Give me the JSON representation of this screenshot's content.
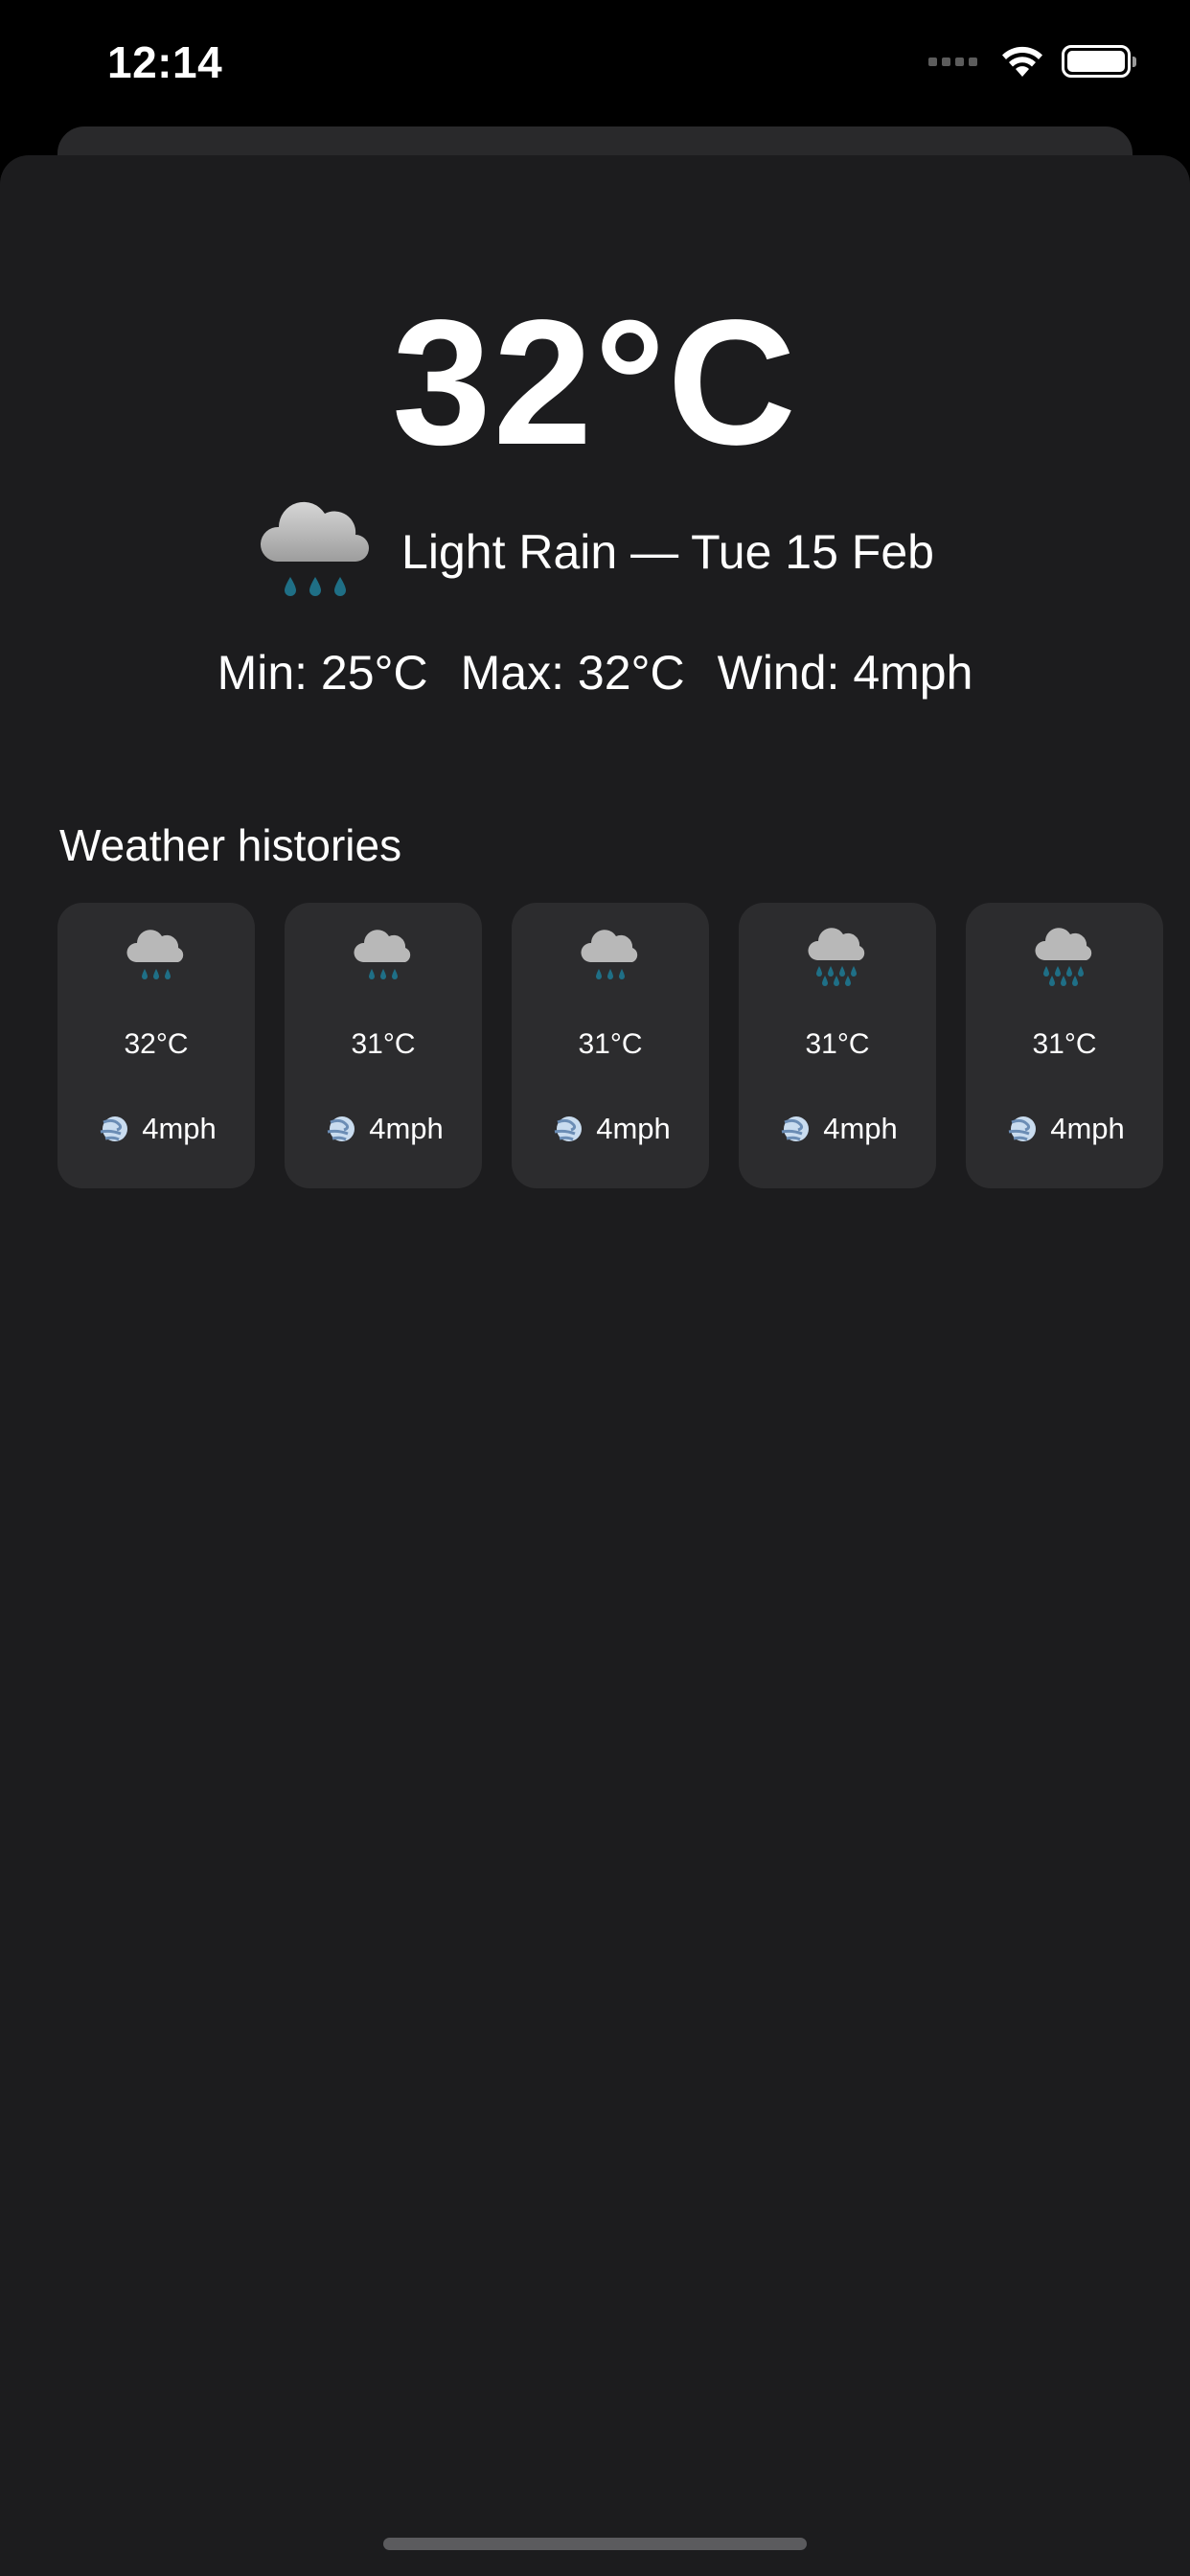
{
  "status_bar": {
    "time": "12:14",
    "wifi_icon": "wifi-icon",
    "battery_icon": "battery-icon"
  },
  "current": {
    "temperature": "32°C",
    "condition_icon": "cloud-rain-icon",
    "condition_text": "Light Rain — Tue 15 Feb",
    "min": "Min: 25°C",
    "max": "Max: 32°C",
    "wind": "Wind: 4mph"
  },
  "histories": {
    "title": "Weather histories",
    "items": [
      {
        "icon": "cloud-rain-icon",
        "temp": "32°C",
        "wind": "4mph"
      },
      {
        "icon": "cloud-rain-icon",
        "temp": "31°C",
        "wind": "4mph"
      },
      {
        "icon": "cloud-rain-icon",
        "temp": "31°C",
        "wind": "4mph"
      },
      {
        "icon": "cloud-heavy-rain-icon",
        "temp": "31°C",
        "wind": "4mph"
      },
      {
        "icon": "cloud-heavy-rain-icon",
        "temp": "31°C",
        "wind": "4mph"
      }
    ],
    "wind_icon": "wind-icon"
  },
  "colors": {
    "background": "#000000",
    "sheet": "#1c1c1e",
    "card": "#2c2c2e",
    "text": "#ffffff",
    "rain_drop": "#1f6f86",
    "cloud": "#b8b8b8"
  }
}
